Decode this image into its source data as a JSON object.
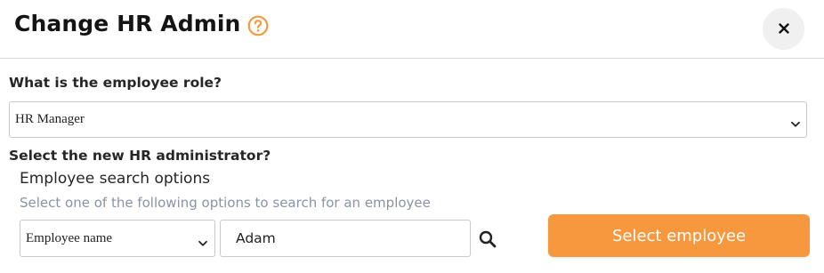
{
  "dialog": {
    "title": "Change HR Admin",
    "help_icon": "question-circle-icon",
    "close_icon": "close-icon"
  },
  "role": {
    "question": "What is the employee role?",
    "selected": "HR Manager"
  },
  "admin": {
    "question": "Select the new HR administrator?",
    "search_heading": "Employee search options",
    "search_hint": "Select one of the following options to search for an employee",
    "search_option_selected": "Employee name",
    "search_value": "Adam",
    "search_icon": "search-icon",
    "select_button_label": "Select employee"
  },
  "colors": {
    "accent": "#f7983e",
    "hint_text": "#8a93a6",
    "close_bg": "#f0f0f0"
  }
}
